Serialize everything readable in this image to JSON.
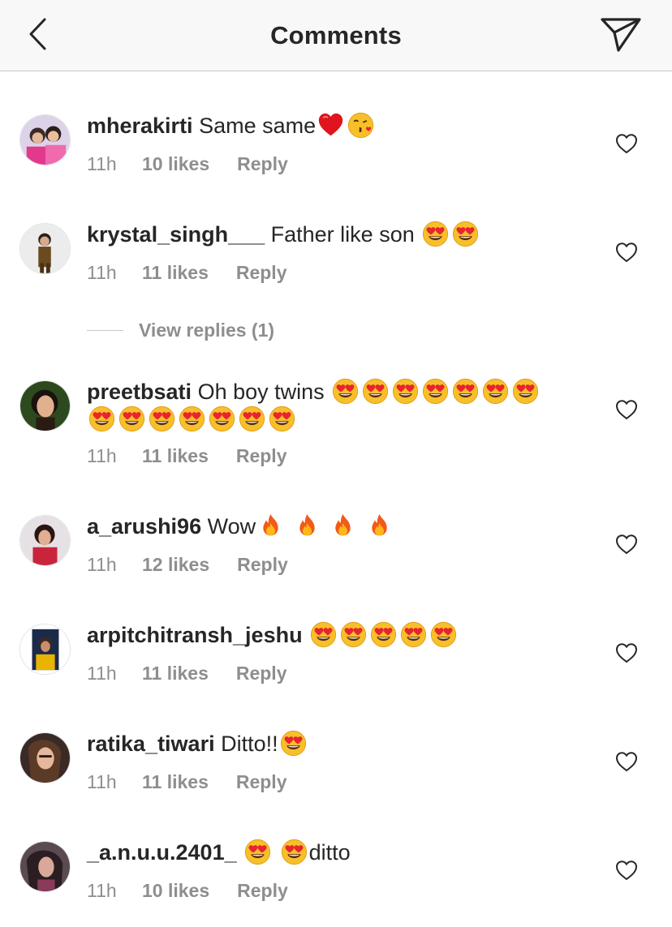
{
  "header": {
    "title": "Comments",
    "back_icon": "chevron-left-icon",
    "send_icon": "direct-send-icon"
  },
  "colors": {
    "header_bg": "#f8f8f8",
    "text": "#262626",
    "muted": "#8e8e8e",
    "heart_red": "#e8242f"
  },
  "comments": [
    {
      "username": "mherakirti",
      "text": "Same same",
      "emojis_after": [
        "red-heart-emoji",
        "face-blowing-kiss-emoji"
      ],
      "time": "11h",
      "likes": "10 likes",
      "reply": "Reply"
    },
    {
      "username": "krystal_singh___",
      "text": "Father like son",
      "emojis_after": [
        "heart-eyes-emoji",
        "heart-eyes-emoji"
      ],
      "time": "11h",
      "likes": "11 likes",
      "reply": "Reply"
    },
    {
      "username": "preetbsati",
      "text": "Oh boy twins",
      "emojis_after": [
        "heart-eyes-emoji x14"
      ],
      "time": "11h",
      "likes": "11 likes",
      "reply": "Reply"
    },
    {
      "username": "a_arushi96",
      "text": "Wow",
      "emojis_after": [
        "fire-emoji x4"
      ],
      "time": "11h",
      "likes": "12 likes",
      "reply": "Reply"
    },
    {
      "username": "arpitchitransh_jeshu",
      "text": "",
      "emojis_after": [
        "heart-eyes-emoji x5"
      ],
      "time": "11h",
      "likes": "11 likes",
      "reply": "Reply"
    },
    {
      "username": "ratika_tiwari",
      "text": "Ditto!!",
      "emojis_after": [
        "heart-eyes-emoji"
      ],
      "time": "11h",
      "likes": "11 likes",
      "reply": "Reply"
    },
    {
      "username": "_a.n.u.u.2401_",
      "text": "",
      "text_after": "ditto",
      "emojis_after": [
        "heart-eyes-emoji",
        "heart-eyes-emoji"
      ],
      "time": "11h",
      "likes": "10 likes",
      "reply": "Reply"
    }
  ],
  "view_replies": "View replies (1)"
}
